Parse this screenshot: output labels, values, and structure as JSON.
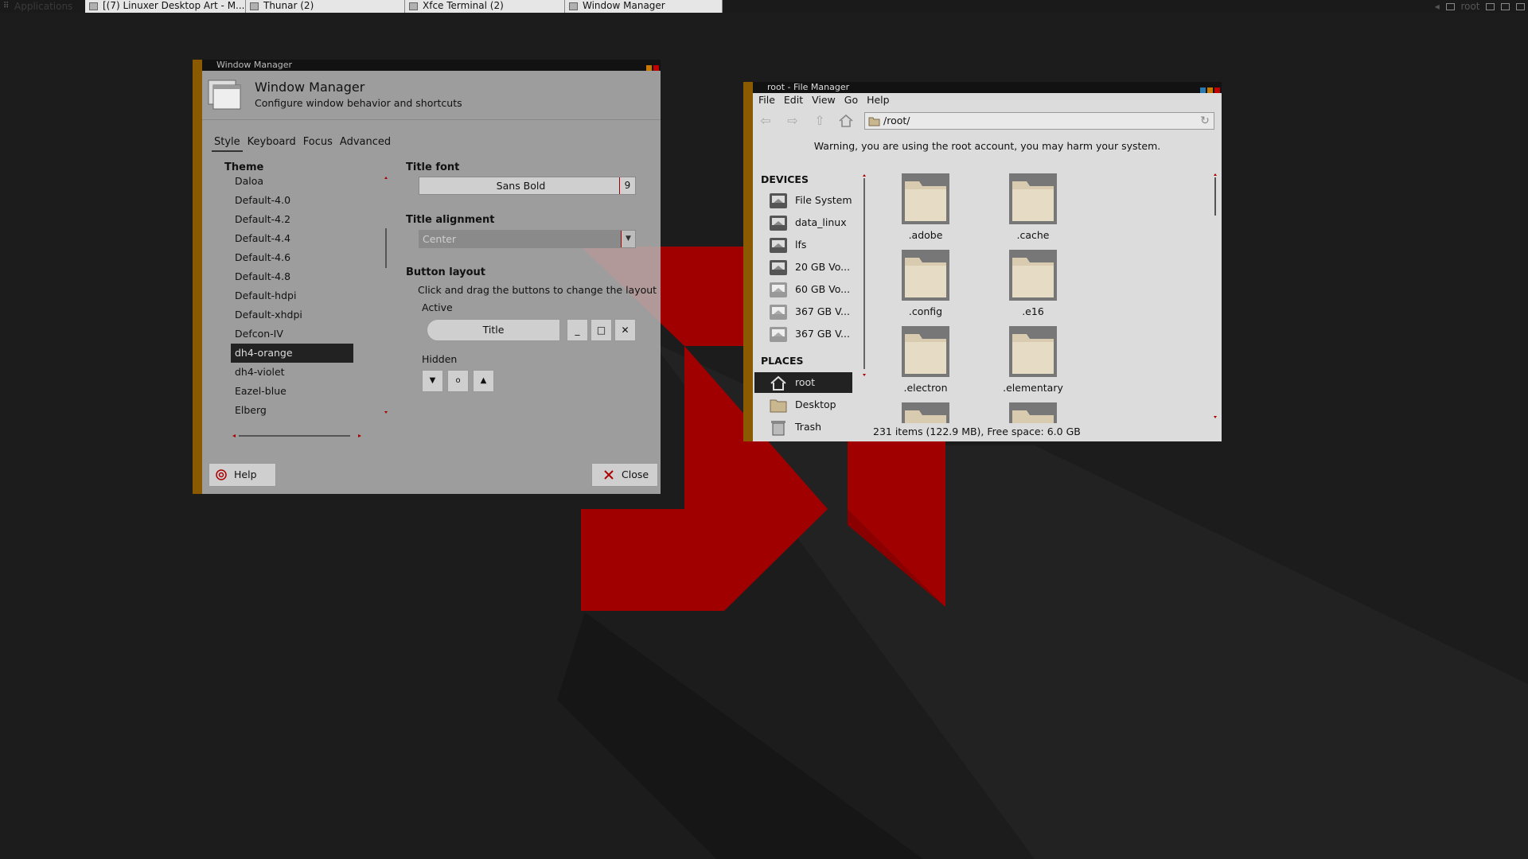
{
  "panel": {
    "applications_label": "Applications",
    "tasks": [
      {
        "label": "[(7) Linuxer Desktop Art - M..."
      },
      {
        "label": "Thunar (2)"
      },
      {
        "label": "Xfce Terminal (2)"
      },
      {
        "label": "Window Manager"
      }
    ],
    "tray_user": "root"
  },
  "wm": {
    "window_title": "Window Manager",
    "heading": "Window Manager",
    "subheading": "Configure window behavior and shortcuts",
    "tabs": [
      {
        "label": "Style"
      },
      {
        "label": "Keyboard"
      },
      {
        "label": "Focus"
      },
      {
        "label": "Advanced"
      }
    ],
    "theme_label": "Theme",
    "themes": [
      "Daloa",
      "Default-4.0",
      "Default-4.2",
      "Default-4.4",
      "Default-4.6",
      "Default-4.8",
      "Default-hdpi",
      "Default-xhdpi",
      "Defcon-IV",
      "dh4-orange",
      "dh4-violet",
      "Eazel-blue",
      "Elberg"
    ],
    "selected_theme": "dh4-orange",
    "title_font_label": "Title font",
    "title_font_name": "Sans Bold",
    "title_font_size": "9",
    "title_alignment_label": "Title alignment",
    "title_alignment_value": "Center",
    "button_layout_label": "Button layout",
    "button_layout_hint": "Click and drag the buttons to change the layout",
    "active_label": "Active",
    "title_slot": "Title",
    "hidden_label": "Hidden",
    "help_button": "Help",
    "close_button": "Close"
  },
  "fm": {
    "window_title": "root - File Manager",
    "menu": [
      {
        "label": "File"
      },
      {
        "label": "Edit"
      },
      {
        "label": "View"
      },
      {
        "label": "Go"
      },
      {
        "label": "Help"
      }
    ],
    "location": "/root/",
    "warning": "Warning, you are using the root account, you may harm your system.",
    "devices_header": "DEVICES",
    "devices": [
      {
        "label": "File System"
      },
      {
        "label": "data_linux"
      },
      {
        "label": "lfs"
      },
      {
        "label": "20 GB Vo..."
      },
      {
        "label": "60 GB Vo..."
      },
      {
        "label": "367 GB V..."
      },
      {
        "label": "367 GB V..."
      }
    ],
    "places_header": "PLACES",
    "places": [
      {
        "label": "root"
      },
      {
        "label": "Desktop"
      },
      {
        "label": "Trash"
      }
    ],
    "folders": [
      {
        "name": ".adobe"
      },
      {
        "name": ".cache"
      },
      {
        "name": ".config"
      },
      {
        "name": ".e16"
      },
      {
        "name": ".electron"
      },
      {
        "name": ".elementary"
      }
    ],
    "status": "231 items (122.9 MB), Free space: 6.0 GB"
  },
  "colors": {
    "accent_red": "#a00000",
    "frame_orange": "#8b5a00",
    "selection_dark": "#222222"
  }
}
